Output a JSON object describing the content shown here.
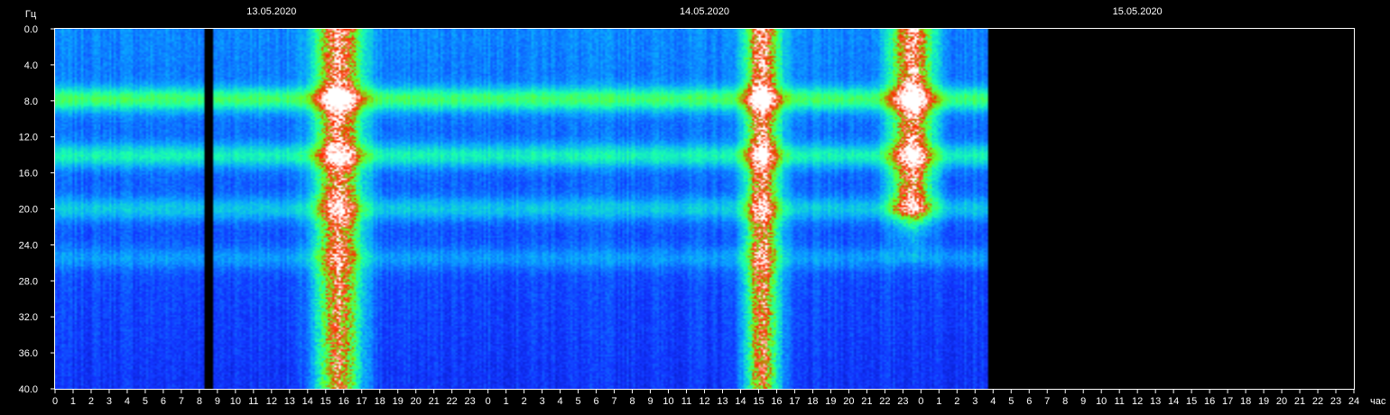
{
  "chart_data": {
    "type": "heatmap",
    "title": "",
    "ylabel": "Гц",
    "xlabel": "час",
    "ylim": [
      0,
      40
    ],
    "y_direction": "top-to-bottom",
    "y_ticks": [
      "0.0",
      "4.0",
      "8.0",
      "12.0",
      "16.0",
      "20.0",
      "24.0",
      "28.0",
      "32.0",
      "36.0",
      "40.0"
    ],
    "x_ticks": [
      "0",
      "1",
      "2",
      "3",
      "4",
      "5",
      "6",
      "7",
      "8",
      "9",
      "10",
      "11",
      "12",
      "13",
      "14",
      "15",
      "16",
      "17",
      "18",
      "19",
      "20",
      "21",
      "22",
      "23",
      "0",
      "1",
      "2",
      "3",
      "4",
      "5",
      "6",
      "7",
      "8",
      "9",
      "10",
      "11",
      "12",
      "13",
      "14",
      "15",
      "16",
      "17",
      "18",
      "19",
      "20",
      "21",
      "22",
      "23",
      "0",
      "1",
      "2",
      "3",
      "4",
      "5",
      "6",
      "7",
      "8",
      "9",
      "10",
      "11",
      "12",
      "13",
      "14",
      "15",
      "16",
      "17",
      "18",
      "19",
      "20",
      "21",
      "22",
      "23",
      "24"
    ],
    "dates": [
      {
        "label": "13.05.2020",
        "hour": 12
      },
      {
        "label": "14.05.2020",
        "hour": 36
      },
      {
        "label": "15.05.2020",
        "hour": 60
      }
    ],
    "data_end_hour": 51.7,
    "gap_hours": [
      8.3,
      8.8
    ],
    "bands_hz": [
      7.8,
      14.1,
      20.0,
      25.5
    ],
    "bursts": [
      {
        "start_hour": 13.9,
        "end_hour": 17.6,
        "from_hz": 0,
        "to_hz": 40
      },
      {
        "start_hour": 37.8,
        "end_hour": 40.6,
        "from_hz": 0,
        "to_hz": 40
      },
      {
        "start_hour": 45.8,
        "end_hour": 49.2,
        "from_hz": 0,
        "to_hz": 20
      }
    ],
    "colorscale": [
      "#000a9e",
      "#1235ff",
      "#0aa8ff",
      "#18ffb0",
      "#6cff20",
      "#ff2a00",
      "#ffffff"
    ]
  }
}
